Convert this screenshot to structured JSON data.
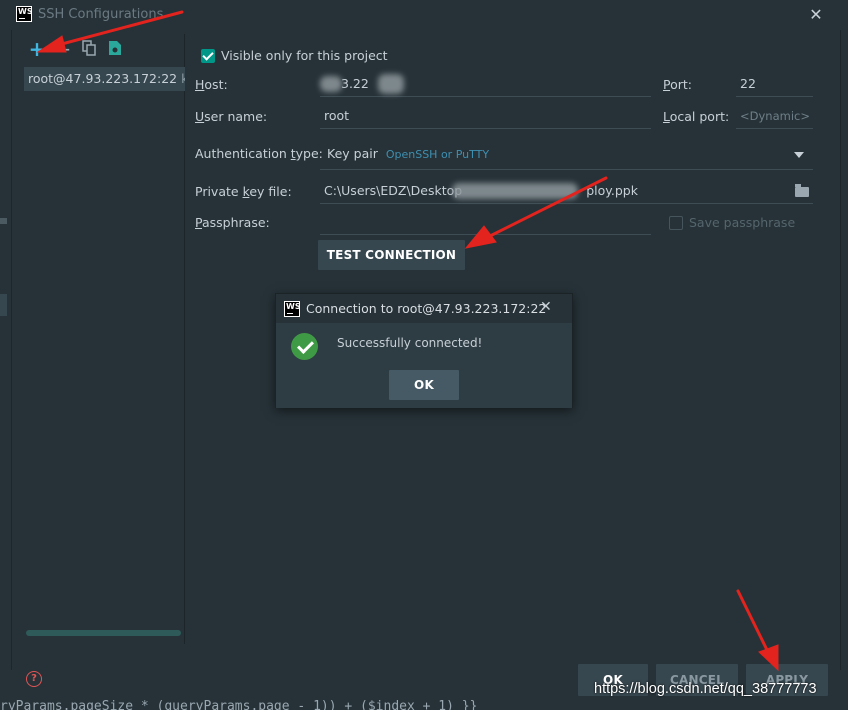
{
  "window": {
    "title": "SSH Configurations",
    "logo": "WS"
  },
  "sidebar": {
    "toolbar": {
      "add": "+",
      "remove": "−",
      "copy_icon": "copy-icon",
      "save_icon": "save-icon"
    },
    "items": [
      {
        "label": "root@47.93.223.172:22",
        "sub": "key"
      }
    ]
  },
  "form": {
    "visible_only": {
      "label": "Visible only for this project",
      "checked": true
    },
    "host": {
      "label": "Host:",
      "value": "3.22"
    },
    "port": {
      "label": "Port:",
      "value": "22"
    },
    "username": {
      "label": "User name:",
      "value": "root"
    },
    "local_port": {
      "label": "Local port:",
      "placeholder": "<Dynamic>"
    },
    "auth_type": {
      "label": "Authentication type:",
      "value": "Key pair",
      "hint": "OpenSSH or PuTTY"
    },
    "private_key": {
      "label": "Private key file:",
      "value_prefix": "C:\\Users\\EDZ\\Desktop",
      "value_suffix": "ploy.ppk"
    },
    "passphrase": {
      "label": "Passphrase:",
      "value": ""
    },
    "save_passphrase": {
      "label": "Save passphrase",
      "checked": false
    },
    "test_connection": "TEST CONNECTION"
  },
  "popup": {
    "title": "Connection to root@47.93.223.172:22",
    "message": "Successfully connected!",
    "ok": "OK"
  },
  "footer": {
    "ok": "OK",
    "cancel": "CANCEL",
    "apply": "APPLY",
    "help": "?"
  },
  "background_code": "ryParams.pageSize * (queryParams.page - 1)) + ($index + 1) }}",
  "watermark": "https://blog.csdn.net/qq_38777773",
  "colors": {
    "accent": "#009688",
    "arrow": "#e3231d",
    "success": "#3f9a45"
  }
}
